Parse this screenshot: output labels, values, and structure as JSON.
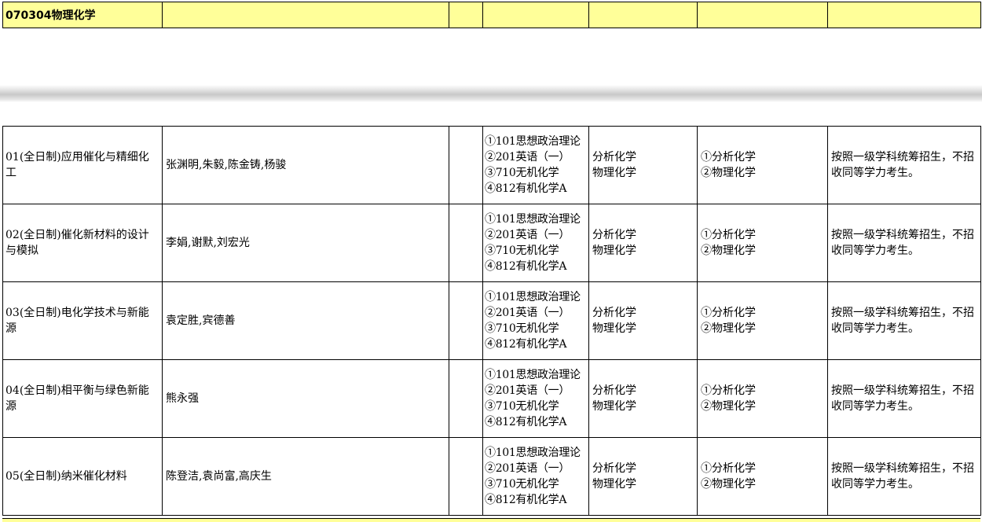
{
  "header": {
    "code_name": "070304物理化学"
  },
  "rows": [
    {
      "direction": "01(全日制)应用催化与精细化工",
      "tutors": "张渊明,朱毅,陈金铸,杨骏",
      "exams": [
        "①101思想政治理论",
        "②201英语（一）",
        "③710无机化学",
        "④812有机化学A"
      ],
      "retest": [
        "分析化学",
        "物理化学"
      ],
      "extra": [
        "①分析化学",
        "②物理化学"
      ],
      "note": "按照一级学科统筹招生，不招收同等学力考生。"
    },
    {
      "direction": "02(全日制)催化新材料的设计与模拟",
      "tutors": "李娟,谢默,刘宏光",
      "exams": [
        "①101思想政治理论",
        "②201英语（一）",
        "③710无机化学",
        "④812有机化学A"
      ],
      "retest": [
        "分析化学",
        "物理化学"
      ],
      "extra": [
        "①分析化学",
        "②物理化学"
      ],
      "note": "按照一级学科统筹招生，不招收同等学力考生。"
    },
    {
      "direction": "03(全日制)电化学技术与新能源",
      "tutors": "袁定胜,宾德善",
      "exams": [
        "①101思想政治理论",
        "②201英语（一）",
        "③710无机化学",
        "④812有机化学A"
      ],
      "retest": [
        "分析化学",
        "物理化学"
      ],
      "extra": [
        "①分析化学",
        "②物理化学"
      ],
      "note": "按照一级学科统筹招生，不招收同等学力考生。"
    },
    {
      "direction": "04(全日制)相平衡与绿色新能源",
      "tutors": "熊永强",
      "exams": [
        "①101思想政治理论",
        "②201英语（一）",
        "③710无机化学",
        "④812有机化学A"
      ],
      "retest": [
        "分析化学",
        "物理化学"
      ],
      "extra": [
        "①分析化学",
        "②物理化学"
      ],
      "note": "按照一级学科统筹招生，不招收同等学力考生。"
    },
    {
      "direction": "05(全日制)纳米催化材料",
      "tutors": "陈登洁,袁尚富,高庆生",
      "exams": [
        "①101思想政治理论",
        "②201英语（一）",
        "③710无机化学",
        "④812有机化学A"
      ],
      "retest": [
        "分析化学",
        "物理化学"
      ],
      "extra": [
        "①分析化学",
        "②物理化学"
      ],
      "note": "按照一级学科统筹招生，不招收同等学力考生。"
    }
  ]
}
